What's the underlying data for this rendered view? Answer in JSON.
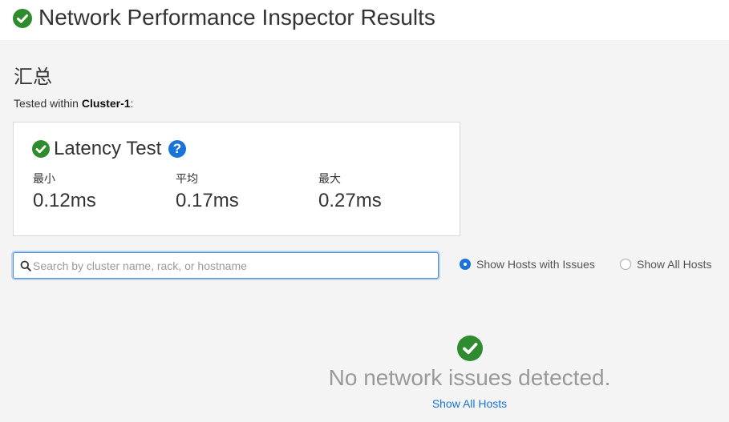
{
  "header": {
    "title": "Network Performance Inspector Results",
    "icon": "check-circle-icon",
    "success_color": "#2e8b2e"
  },
  "summary": {
    "heading": "汇总",
    "tested_within_prefix": "Tested within ",
    "cluster_name": "Cluster-1",
    "tested_within_suffix": ":"
  },
  "latency_card": {
    "title": "Latency Test",
    "help_icon": "?",
    "stats": [
      {
        "label": "最小",
        "value": "0.12ms"
      },
      {
        "label": "平均",
        "value": "0.17ms"
      },
      {
        "label": "最大",
        "value": "0.27ms"
      }
    ]
  },
  "filter": {
    "search_placeholder": "Search by cluster name, rack, or hostname",
    "search_value": "",
    "radio_options": [
      {
        "label": "Show Hosts with Issues",
        "selected": true
      },
      {
        "label": "Show All Hosts",
        "selected": false
      }
    ],
    "accent_color": "#1a73d9"
  },
  "empty_state": {
    "message": "No network issues detected.",
    "link_label": "Show All Hosts"
  }
}
